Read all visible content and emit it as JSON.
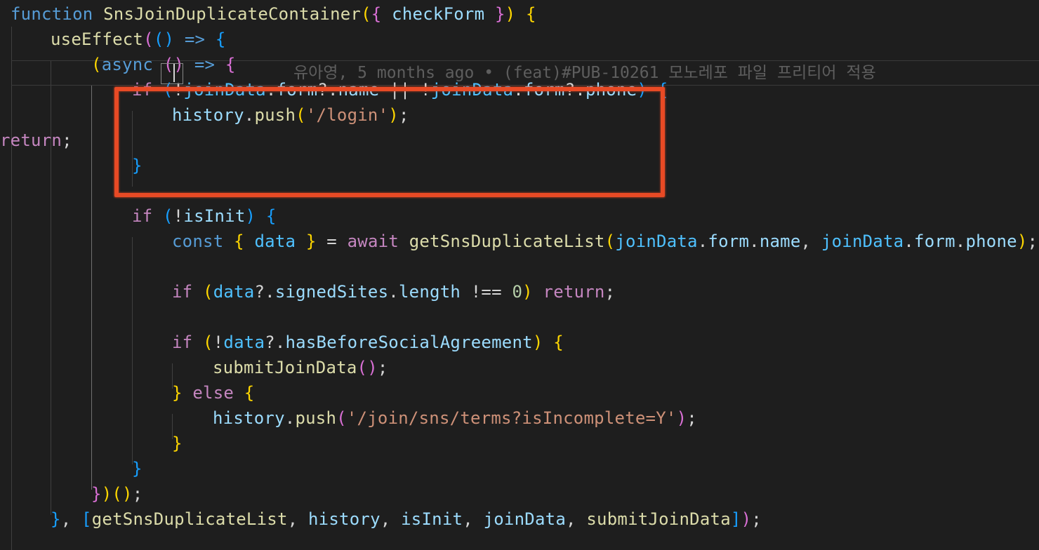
{
  "colors": {
    "background": "#1e1e1e",
    "annotation": "#e84a25",
    "keyword_blue": "#569cd6",
    "control_purple": "#c586c0",
    "function_yellow": "#dcdcaa",
    "variable_lightblue": "#9cdcfe",
    "constant_blue": "#4fc1ff",
    "string_orange": "#ce9178",
    "number_green": "#b5cea8",
    "punctuation": "#d4d4d4",
    "bracket_gold": "#ffd700",
    "bracket_pink": "#da70d6",
    "bracket_blue": "#179fff",
    "blame_gray": "#5e5e5e"
  },
  "blame": "유아영, 5 months ago • (feat)#PUB-10261 모노레포 파일 프리티어 적용",
  "lines": [
    {
      "tokens": [
        {
          "t": "function ",
          "c": "#569cd6"
        },
        {
          "t": "SnsJoinDuplicateContainer",
          "c": "#dcdcaa"
        },
        {
          "t": "(",
          "c": "#ffd700"
        },
        {
          "t": "{",
          "c": "#da70d6"
        },
        {
          "t": " ",
          "c": "#d4d4d4"
        },
        {
          "t": "checkForm",
          "c": "#9cdcfe"
        },
        {
          "t": " ",
          "c": "#d4d4d4"
        },
        {
          "t": "}",
          "c": "#da70d6"
        },
        {
          "t": ")",
          "c": "#ffd700"
        },
        {
          "t": " ",
          "c": "#d4d4d4"
        },
        {
          "t": "{",
          "c": "#ffd700"
        }
      ]
    },
    {
      "tokens": [
        {
          "t": "useEffect",
          "c": "#dcdcaa"
        },
        {
          "t": "(",
          "c": "#da70d6"
        },
        {
          "t": "()",
          "c": "#179fff"
        },
        {
          "t": " => ",
          "c": "#569cd6"
        },
        {
          "t": "{",
          "c": "#179fff"
        }
      ]
    },
    {
      "tokens": [
        {
          "t": "(",
          "c": "#ffd700"
        },
        {
          "t": "async",
          "c": "#569cd6"
        },
        {
          "t": " ",
          "c": "#d4d4d4"
        },
        {
          "t": "()",
          "c": "#da70d6"
        },
        {
          "t": " => ",
          "c": "#569cd6"
        },
        {
          "t": "{",
          "c": "#da70d6"
        }
      ]
    },
    {
      "tokens": [
        {
          "t": "if",
          "c": "#c586c0"
        },
        {
          "t": " ",
          "c": "#d4d4d4"
        },
        {
          "t": "(",
          "c": "#179fff"
        },
        {
          "t": "!",
          "c": "#d4d4d4"
        },
        {
          "t": "joinData",
          "c": "#4fc1ff"
        },
        {
          "t": ".",
          "c": "#d4d4d4"
        },
        {
          "t": "form",
          "c": "#9cdcfe"
        },
        {
          "t": "?.",
          "c": "#d4d4d4"
        },
        {
          "t": "name",
          "c": "#9cdcfe"
        },
        {
          "t": " || !",
          "c": "#d4d4d4"
        },
        {
          "t": "joinData",
          "c": "#4fc1ff"
        },
        {
          "t": ".",
          "c": "#d4d4d4"
        },
        {
          "t": "form",
          "c": "#9cdcfe"
        },
        {
          "t": "?.",
          "c": "#d4d4d4"
        },
        {
          "t": "phone",
          "c": "#9cdcfe"
        },
        {
          "t": ")",
          "c": "#179fff"
        },
        {
          "t": " ",
          "c": "#d4d4d4"
        },
        {
          "t": "{",
          "c": "#179fff"
        }
      ]
    },
    {
      "tokens": [
        {
          "t": "history",
          "c": "#9cdcfe"
        },
        {
          "t": ".",
          "c": "#d4d4d4"
        },
        {
          "t": "push",
          "c": "#dcdcaa"
        },
        {
          "t": "(",
          "c": "#ffd700"
        },
        {
          "t": "'/login'",
          "c": "#ce9178"
        },
        {
          "t": ")",
          "c": "#ffd700"
        },
        {
          "t": ";",
          "c": "#d4d4d4"
        }
      ]
    },
    {
      "tokens": [
        {
          "t": "return",
          "c": "#c586c0"
        },
        {
          "t": ";",
          "c": "#d4d4d4"
        }
      ]
    },
    {
      "tokens": [
        {
          "t": "}",
          "c": "#179fff"
        }
      ]
    },
    {
      "tokens": []
    },
    {
      "tokens": [
        {
          "t": "if",
          "c": "#c586c0"
        },
        {
          "t": " ",
          "c": "#d4d4d4"
        },
        {
          "t": "(",
          "c": "#179fff"
        },
        {
          "t": "!",
          "c": "#d4d4d4"
        },
        {
          "t": "isInit",
          "c": "#9cdcfe"
        },
        {
          "t": ")",
          "c": "#179fff"
        },
        {
          "t": " ",
          "c": "#d4d4d4"
        },
        {
          "t": "{",
          "c": "#179fff"
        }
      ]
    },
    {
      "tokens": [
        {
          "t": "const",
          "c": "#569cd6"
        },
        {
          "t": " ",
          "c": "#d4d4d4"
        },
        {
          "t": "{",
          "c": "#ffd700"
        },
        {
          "t": " ",
          "c": "#d4d4d4"
        },
        {
          "t": "data",
          "c": "#4fc1ff"
        },
        {
          "t": " ",
          "c": "#d4d4d4"
        },
        {
          "t": "}",
          "c": "#ffd700"
        },
        {
          "t": " = ",
          "c": "#d4d4d4"
        },
        {
          "t": "await",
          "c": "#c586c0"
        },
        {
          "t": " ",
          "c": "#d4d4d4"
        },
        {
          "t": "getSnsDuplicateList",
          "c": "#dcdcaa"
        },
        {
          "t": "(",
          "c": "#ffd700"
        },
        {
          "t": "joinData",
          "c": "#4fc1ff"
        },
        {
          "t": ".",
          "c": "#d4d4d4"
        },
        {
          "t": "form",
          "c": "#9cdcfe"
        },
        {
          "t": ".",
          "c": "#d4d4d4"
        },
        {
          "t": "name",
          "c": "#9cdcfe"
        },
        {
          "t": ", ",
          "c": "#d4d4d4"
        },
        {
          "t": "joinData",
          "c": "#4fc1ff"
        },
        {
          "t": ".",
          "c": "#d4d4d4"
        },
        {
          "t": "form",
          "c": "#9cdcfe"
        },
        {
          "t": ".",
          "c": "#d4d4d4"
        },
        {
          "t": "phone",
          "c": "#9cdcfe"
        },
        {
          "t": ")",
          "c": "#ffd700"
        },
        {
          "t": ";",
          "c": "#d4d4d4"
        }
      ]
    },
    {
      "tokens": []
    },
    {
      "tokens": [
        {
          "t": "if",
          "c": "#c586c0"
        },
        {
          "t": " ",
          "c": "#d4d4d4"
        },
        {
          "t": "(",
          "c": "#ffd700"
        },
        {
          "t": "data",
          "c": "#4fc1ff"
        },
        {
          "t": "?.",
          "c": "#d4d4d4"
        },
        {
          "t": "signedSites",
          "c": "#9cdcfe"
        },
        {
          "t": ".",
          "c": "#d4d4d4"
        },
        {
          "t": "length",
          "c": "#9cdcfe"
        },
        {
          "t": " !== ",
          "c": "#d4d4d4"
        },
        {
          "t": "0",
          "c": "#b5cea8"
        },
        {
          "t": ")",
          "c": "#ffd700"
        },
        {
          "t": " ",
          "c": "#d4d4d4"
        },
        {
          "t": "return",
          "c": "#c586c0"
        },
        {
          "t": ";",
          "c": "#d4d4d4"
        }
      ]
    },
    {
      "tokens": []
    },
    {
      "tokens": [
        {
          "t": "if",
          "c": "#c586c0"
        },
        {
          "t": " ",
          "c": "#d4d4d4"
        },
        {
          "t": "(",
          "c": "#ffd700"
        },
        {
          "t": "!",
          "c": "#d4d4d4"
        },
        {
          "t": "data",
          "c": "#4fc1ff"
        },
        {
          "t": "?.",
          "c": "#d4d4d4"
        },
        {
          "t": "hasBeforeSocialAgreement",
          "c": "#9cdcfe"
        },
        {
          "t": ")",
          "c": "#ffd700"
        },
        {
          "t": " ",
          "c": "#d4d4d4"
        },
        {
          "t": "{",
          "c": "#ffd700"
        }
      ]
    },
    {
      "tokens": [
        {
          "t": "submitJoinData",
          "c": "#dcdcaa"
        },
        {
          "t": "()",
          "c": "#da70d6"
        },
        {
          "t": ";",
          "c": "#d4d4d4"
        }
      ]
    },
    {
      "tokens": [
        {
          "t": "}",
          "c": "#ffd700"
        },
        {
          "t": " ",
          "c": "#d4d4d4"
        },
        {
          "t": "else",
          "c": "#c586c0"
        },
        {
          "t": " ",
          "c": "#d4d4d4"
        },
        {
          "t": "{",
          "c": "#ffd700"
        }
      ]
    },
    {
      "tokens": [
        {
          "t": "history",
          "c": "#9cdcfe"
        },
        {
          "t": ".",
          "c": "#d4d4d4"
        },
        {
          "t": "push",
          "c": "#dcdcaa"
        },
        {
          "t": "(",
          "c": "#da70d6"
        },
        {
          "t": "'/join/sns/terms?isIncomplete=Y'",
          "c": "#ce9178"
        },
        {
          "t": ")",
          "c": "#da70d6"
        },
        {
          "t": ";",
          "c": "#d4d4d4"
        }
      ]
    },
    {
      "tokens": [
        {
          "t": "}",
          "c": "#ffd700"
        }
      ]
    },
    {
      "tokens": [
        {
          "t": "}",
          "c": "#179fff"
        }
      ]
    },
    {
      "tokens": [
        {
          "t": "}",
          "c": "#da70d6"
        },
        {
          "t": ")",
          "c": "#ffd700"
        },
        {
          "t": "()",
          "c": "#ffd700"
        },
        {
          "t": ";",
          "c": "#d4d4d4"
        }
      ]
    },
    {
      "tokens": [
        {
          "t": "}",
          "c": "#179fff"
        },
        {
          "t": ", ",
          "c": "#d4d4d4"
        },
        {
          "t": "[",
          "c": "#179fff"
        },
        {
          "t": "getSnsDuplicateList",
          "c": "#dcdcaa"
        },
        {
          "t": ", ",
          "c": "#d4d4d4"
        },
        {
          "t": "history",
          "c": "#9cdcfe"
        },
        {
          "t": ", ",
          "c": "#d4d4d4"
        },
        {
          "t": "isInit",
          "c": "#9cdcfe"
        },
        {
          "t": ", ",
          "c": "#d4d4d4"
        },
        {
          "t": "joinData",
          "c": "#9cdcfe"
        },
        {
          "t": ", ",
          "c": "#d4d4d4"
        },
        {
          "t": "submitJoinData",
          "c": "#dcdcaa"
        },
        {
          "t": "]",
          "c": "#179fff"
        },
        {
          "t": ")",
          "c": "#da70d6"
        },
        {
          "t": ";",
          "c": "#d4d4d4"
        }
      ]
    }
  ]
}
